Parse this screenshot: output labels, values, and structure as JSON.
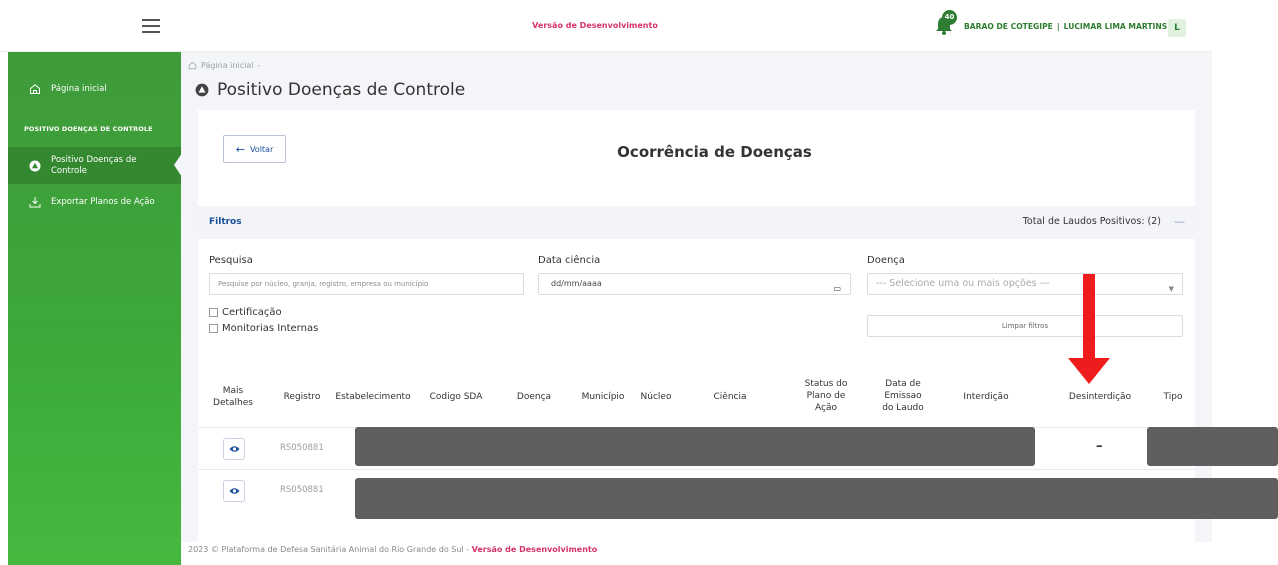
{
  "header": {
    "dev_banner": "Versão de Desenvolvimento",
    "notification_count": "40",
    "location": "BARAO DE COTEGIPE",
    "separator": "|",
    "user_name": "LUCIMAR LIMA MARTINS",
    "avatar_initial": "L"
  },
  "sidebar": {
    "home": "Página inicial",
    "section": "POSITIVO DOENÇAS DE CONTROLE",
    "items": [
      {
        "label": "Positivo Doenças de Controle",
        "active": true
      },
      {
        "label": "Exportar Planos de Ação",
        "active": false
      }
    ]
  },
  "breadcrumb": {
    "home": "Página inicial",
    "sep": "-"
  },
  "page_title": "Positivo Doenças de Controle",
  "card": {
    "back_label": "Voltar",
    "title": "Ocorrência de Doenças",
    "filters_label": "Filtros",
    "total_label": "Total de Laudos Positivos: (2)",
    "collapse_symbol": "—"
  },
  "filters": {
    "search_label": "Pesquisa",
    "search_placeholder": "Pesquise por núcleo, granja, registro, empresa ou município",
    "date_label": "Data ciência",
    "date_placeholder": "dd/mm/aaaa",
    "disease_label": "Doença",
    "disease_placeholder": "--- Selecione uma ou mais opções ---",
    "checkbox_certificacao": "Certificação",
    "checkbox_monitorias": "Monitorias Internas",
    "clear_button": "Limpar filtros"
  },
  "table": {
    "headers": {
      "details": "Mais Detalhes",
      "registro": "Registro",
      "estabelecimento": "Estabelecimento",
      "codigo_sda": "Codigo SDA",
      "doenca": "Doença",
      "municipio": "Município",
      "nucleo": "Núcleo",
      "ciencia": "Ciência",
      "status_plano": "Status do Plano de Ação",
      "data_emissao": "Data de Emissao do Laudo",
      "interdicao": "Interdição",
      "desinterdicao": "Desinterdição",
      "tipo": "Tipo"
    },
    "rows": [
      {
        "registro": "RS050881",
        "desinterdicao": "–"
      },
      {
        "registro": "RS050881"
      }
    ]
  },
  "footer": {
    "text": "2023 © Plataforma de Defesa Sanitária Animal do Rio Grande do Sul -",
    "brand": "Versão de Desenvolvimento"
  },
  "colors": {
    "brand_green": "#3daa3a",
    "accent_pink": "#d6336c",
    "link_blue": "#1a4e9b",
    "annotation_red": "#ee1c1c"
  }
}
